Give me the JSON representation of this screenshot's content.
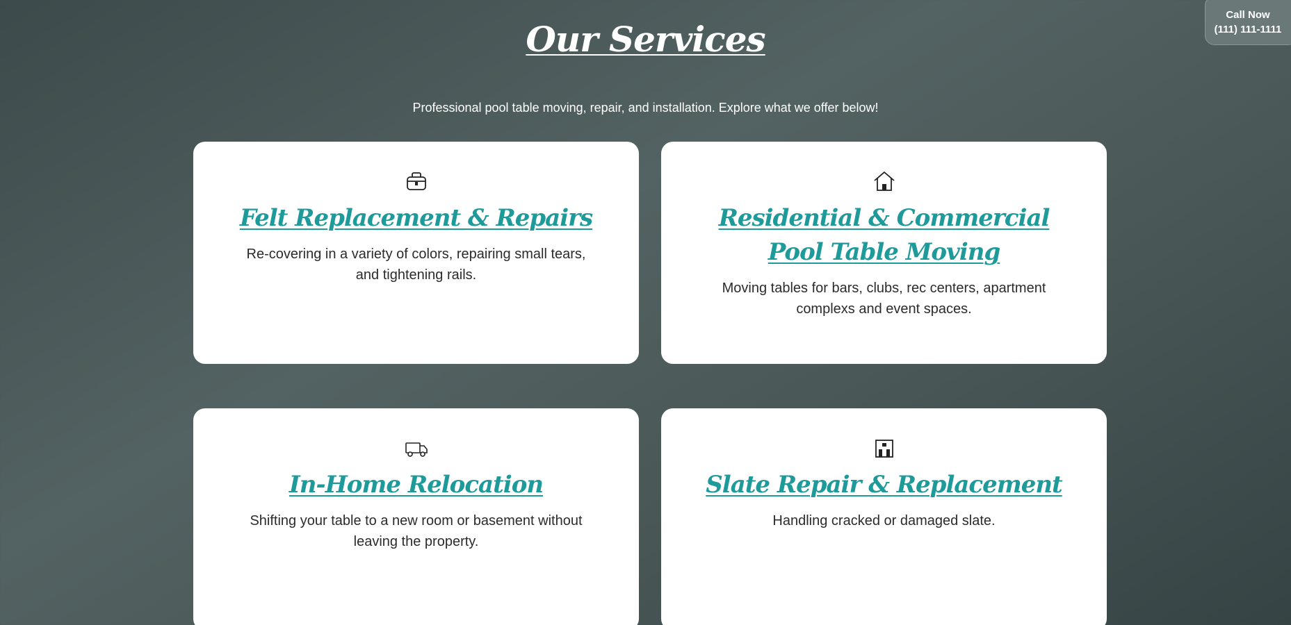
{
  "header": {
    "title": "Our Services",
    "subtitle": "Professional pool table moving, repair, and installation. Explore what we offer below!"
  },
  "call_now": {
    "label": "Call Now",
    "phone": "(111) 111-1111"
  },
  "services": [
    {
      "icon": "toolbox-icon",
      "title": "Felt Replacement & Repairs",
      "description": "Re-covering in a variety of colors, repairing small tears, and tightening rails."
    },
    {
      "icon": "house-icon",
      "title": "Residential & Commercial Pool Table Moving",
      "description": "Moving tables for bars, clubs, rec centers, apartment complexs and event spaces."
    },
    {
      "icon": "truck-icon",
      "title": "In-Home Relocation",
      "description": "Shifting your table to a new room or basement without leaving the property."
    },
    {
      "icon": "building-icon",
      "title": "Slate Repair & Replacement",
      "description": "Handling cracked or damaged slate."
    }
  ],
  "colors": {
    "accent": "#1e9a9a",
    "card_background": "#ffffff",
    "page_background": "#4a5757"
  }
}
